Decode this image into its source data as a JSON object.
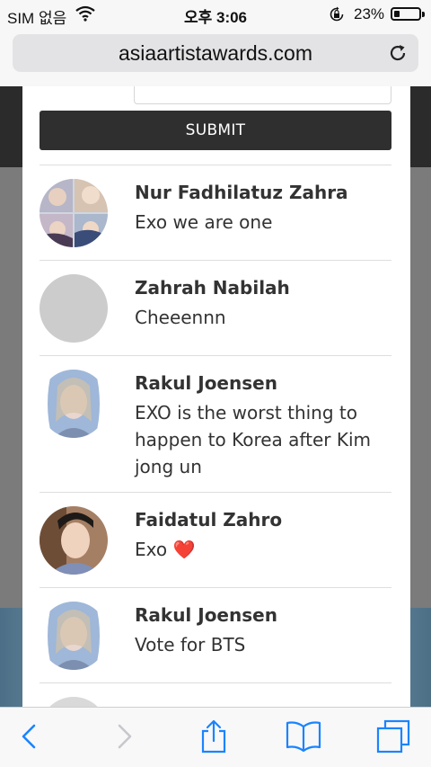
{
  "status": {
    "carrier": "SIM 없음",
    "time": "오후 3:06",
    "battery_pct": "23%",
    "battery_level": 0.23
  },
  "browser": {
    "url": "asiaartistawards.com",
    "icons": [
      "wifi-icon",
      "rotation-lock-icon",
      "reload-icon",
      "back-icon",
      "forward-icon",
      "share-icon",
      "bookmarks-icon",
      "tabs-icon"
    ]
  },
  "form": {
    "submit_label": "SUBMIT"
  },
  "comments": [
    {
      "name": "Nur Fadhilatuz Zahra",
      "text": "Exo we are one"
    },
    {
      "name": "Zahrah Nabilah",
      "text": "Cheeennn"
    },
    {
      "name": "Rakul Joensen",
      "text": "EXO is the worst thing to happen to Korea after Kim jong un"
    },
    {
      "name": "Faidatul Zahro",
      "text": "Exo",
      "emoji": "❤️"
    },
    {
      "name": "Rakul Joensen",
      "text": "Vote for BTS"
    }
  ],
  "colors": {
    "submit_bg": "#2f2f2f",
    "ios_blue": "#1a84ff",
    "heart": "#e0101e"
  }
}
